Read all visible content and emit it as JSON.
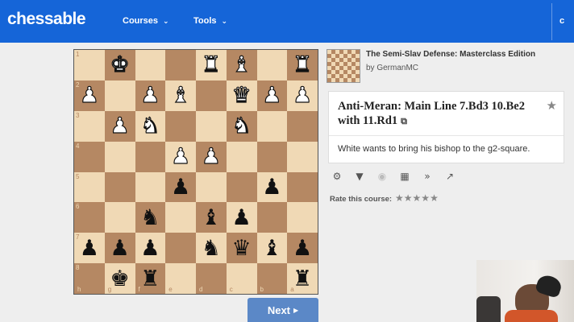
{
  "nav": {
    "logo": "chessable",
    "courses": "Courses",
    "tools": "Tools",
    "right_partial": "c"
  },
  "board": {
    "ranks": [
      "1",
      "2",
      "3",
      "4",
      "5",
      "6",
      "7",
      "8"
    ],
    "files": [
      "h",
      "g",
      "f",
      "e",
      "d",
      "c",
      "b",
      "a"
    ],
    "rows": [
      [
        "",
        "wK",
        "",
        "",
        "wR",
        "wB",
        "",
        "wR"
      ],
      [
        "wP",
        "",
        "wP",
        "wB",
        "",
        "wQ",
        "wP",
        "wP"
      ],
      [
        "",
        "wP",
        "wN",
        "",
        "",
        "wN",
        "",
        ""
      ],
      [
        "",
        "",
        "",
        "wP",
        "wP",
        "",
        "",
        ""
      ],
      [
        "",
        "",
        "",
        "bP",
        "",
        "",
        "bP",
        ""
      ],
      [
        "",
        "",
        "bN",
        "",
        "bB",
        "bP",
        "",
        ""
      ],
      [
        "bP",
        "bP",
        "bP",
        "",
        "bN",
        "bQ",
        "bB",
        "bP"
      ],
      [
        "",
        "bK",
        "bR",
        "",
        "",
        "",
        "",
        "bR"
      ]
    ]
  },
  "next_button": {
    "label": "Next"
  },
  "course": {
    "title": "The Semi-Slav Defense: Masterclass Edition",
    "author": "by GermanMC"
  },
  "chapter": {
    "title": "Anti-Meran: Main Line 7.Bd3 10.Be2 with 11.Rd1",
    "description": "White wants to bring his bishop to the g2-square."
  },
  "toolbar": {
    "icons": [
      "gear-icon",
      "speaker-icon",
      "eye-slash-icon",
      "board-search-icon",
      "double-chevron-right-icon",
      "expand-icon"
    ]
  },
  "rating": {
    "label": "Rate this course:",
    "stars": 5
  },
  "colors": {
    "nav_bg": "#1565d8",
    "board_light": "#f0d9b5",
    "board_dark": "#b58863",
    "next_button": "#5b88c7"
  }
}
